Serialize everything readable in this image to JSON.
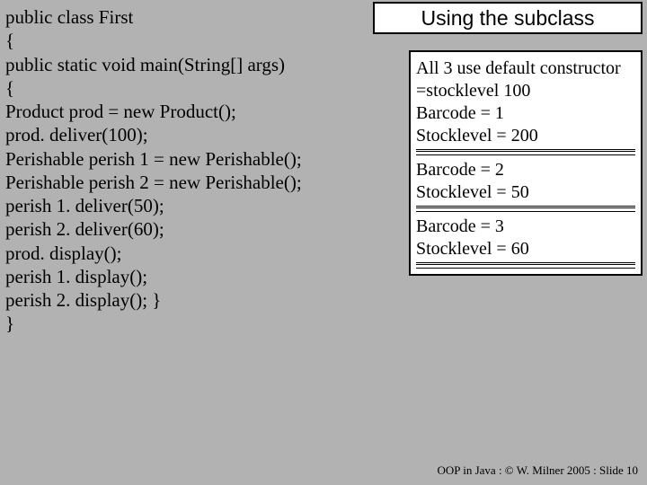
{
  "heading": "Using the subclass",
  "code": {
    "l1": "public class First",
    "l2": "{",
    "l3": "public static void main(String[] args)",
    "l4": "{",
    "l5": "Product prod = new Product();",
    "l6": "prod. deliver(100);",
    "l7": "Perishable perish 1 = new Perishable();",
    "l8": "Perishable perish 2 = new Perishable();",
    "l9": "perish 1. deliver(50);",
    "l10": "perish 2. deliver(60);",
    "l11": "prod. display();",
    "l12": "perish 1. display();",
    "l13": "perish 2. display(); }",
    "l14": "}"
  },
  "output": {
    "l1": "All 3 use default constructor",
    "l2": " =stocklevel 100",
    "l3": "Barcode    = 1",
    "l4": "Stocklevel = 200",
    "l5": "Barcode    = 2",
    "l6": "Stocklevel = 50",
    "l7": "Barcode    = 3",
    "l8": "Stocklevel = 60"
  },
  "footer": "OOP in Java : © W. Milner 2005 : Slide 10"
}
